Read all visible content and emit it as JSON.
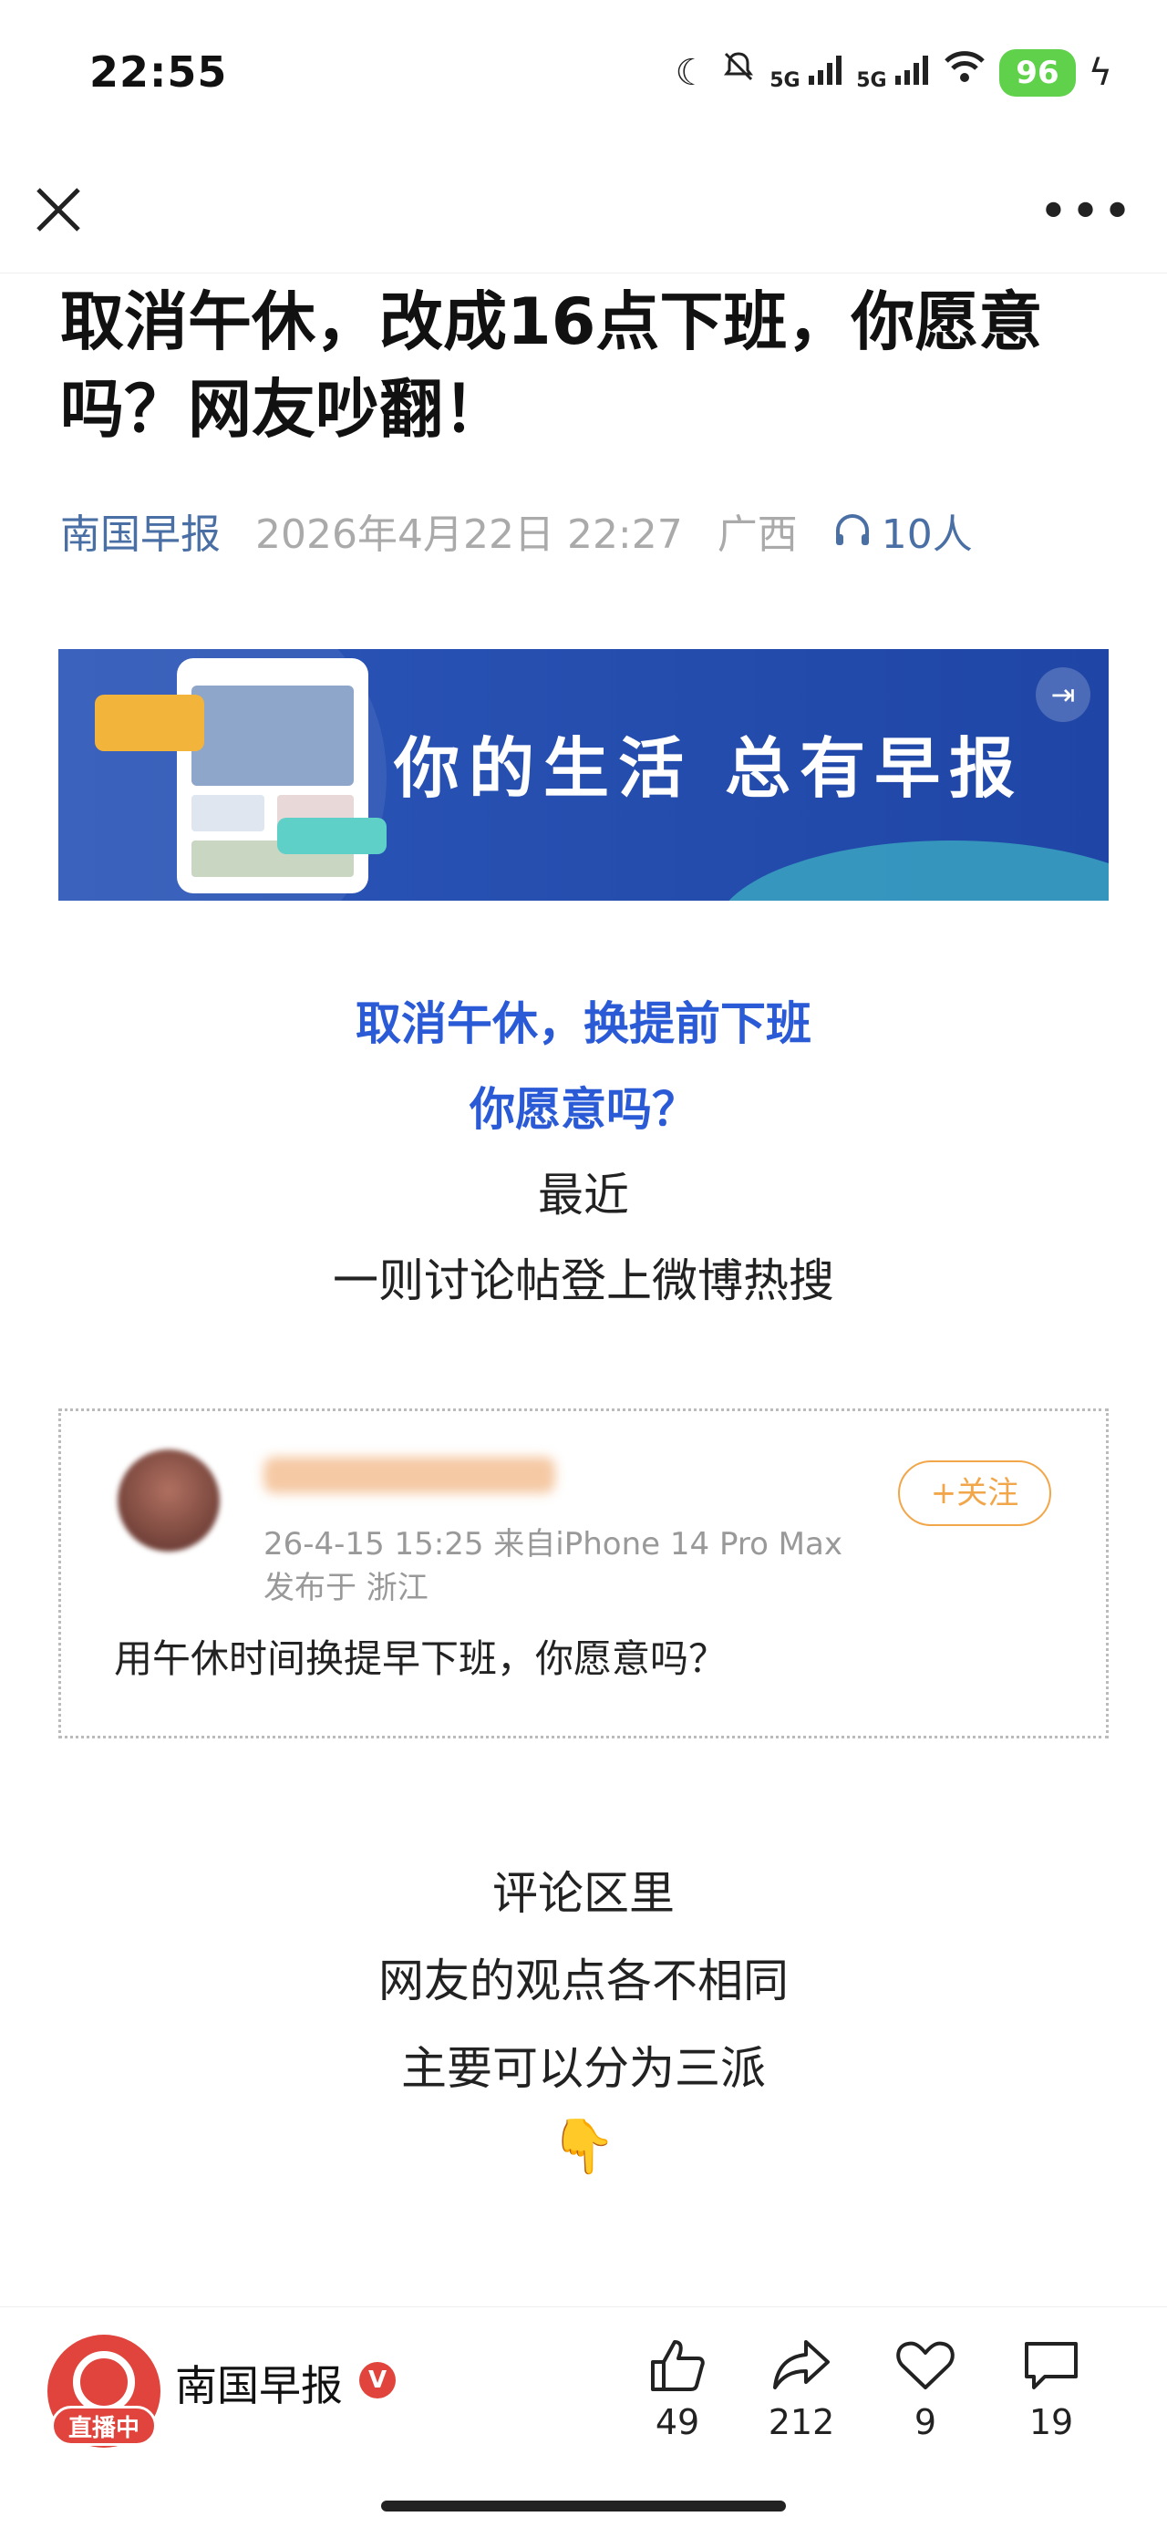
{
  "status_bar": {
    "time": "22:55",
    "battery": "96",
    "network_label": "5G"
  },
  "article": {
    "title": "取消午休，改成16点下班，你愿意吗？网友吵翻！",
    "source": "南国早报",
    "datetime": "2026年4月22日 22:27",
    "location": "广西",
    "listeners": "10人",
    "banner_slogan": "你的生活  总有早报",
    "lead_blue": [
      "取消午休，换提前下班",
      "你愿意吗？"
    ],
    "lead_1": [
      "最近",
      "一则讨论帖登上微博热搜"
    ],
    "embedded_post": {
      "time_device": "26-4-15 15:25  来自iPhone 14 Pro Max",
      "location": "发布于 浙江",
      "follow_label": "+关注",
      "content": "用午休时间换提早下班，你愿意吗？"
    },
    "lead_2": [
      "评论区里",
      "网友的观点各不相同",
      "主要可以分为三派"
    ],
    "emoji": "👇"
  },
  "bottom_bar": {
    "brand": "南国早报",
    "verified": "V",
    "live_badge": "直播中",
    "likes": "49",
    "shares": "212",
    "favorites": "9",
    "comments": "19"
  }
}
